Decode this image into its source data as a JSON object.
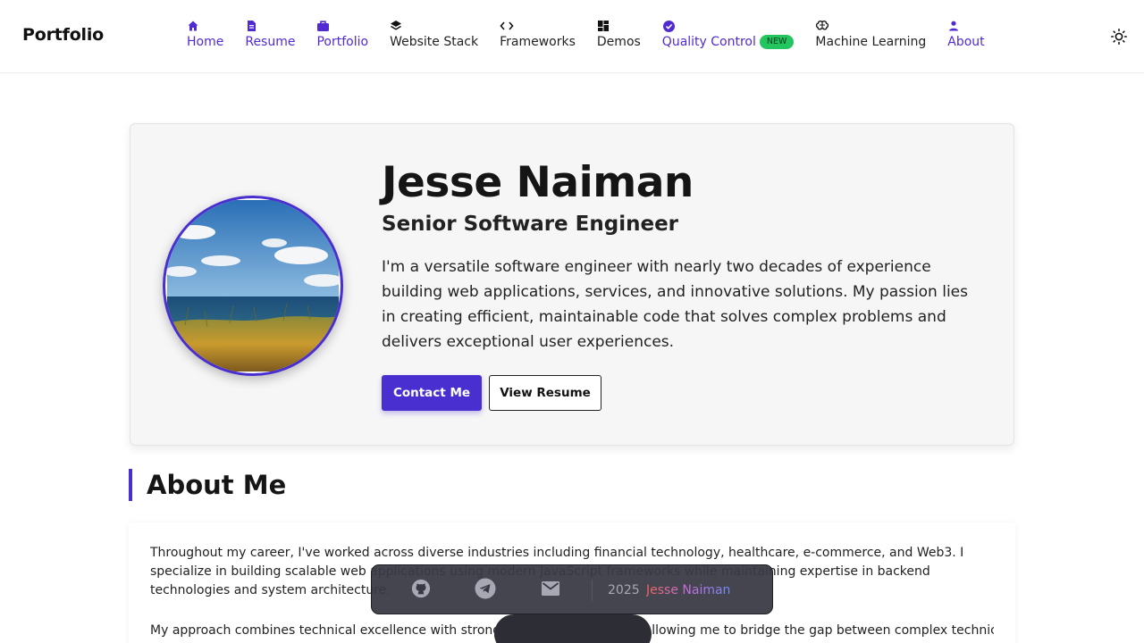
{
  "header": {
    "brand": "Portfolio",
    "nav": [
      {
        "label": "Home",
        "icon": "home-icon",
        "active": true
      },
      {
        "label": "Resume",
        "icon": "document-icon",
        "active": true
      },
      {
        "label": "Portfolio",
        "icon": "briefcase-icon",
        "active": true
      },
      {
        "label": "Website Stack",
        "icon": "layers-icon",
        "active": false
      },
      {
        "label": "Frameworks",
        "icon": "code-icon",
        "active": false
      },
      {
        "label": "Demos",
        "icon": "grid-icon",
        "active": false
      },
      {
        "label": "Quality Control",
        "icon": "verified-badge-icon",
        "active": true,
        "badge": "NEW"
      },
      {
        "label": "Machine Learning",
        "icon": "brain-icon",
        "active": false
      },
      {
        "label": "About",
        "icon": "person-icon",
        "active": true
      }
    ],
    "theme_toggle_icon": "sun-icon"
  },
  "hero": {
    "name": "Jesse Naiman",
    "role": "Senior Software Engineer",
    "bio": "I'm a versatile software engineer with nearly two decades of experience building web applications, services, and innovative solutions. My passion lies in creating efficient, maintainable code that solves complex problems and delivers exceptional user experiences.",
    "primary_button": "Contact Me",
    "secondary_button": "View Resume",
    "avatar_icon": "profile-photo-seascape"
  },
  "about": {
    "heading": "About Me",
    "paragraphs": [
      "Throughout my career, I've worked across diverse industries including financial technology, healthcare, e-commerce, and Web3. I specialize in building scalable web applications using modern JavaScript frameworks while maintaining expertise in backend technologies and system architecture.",
      "My approach combines technical excellence with strong communication skills, allowing me to bridge the gap between complex technical"
    ]
  },
  "footer": {
    "icons": [
      "github-icon",
      "telegram-icon",
      "mail-icon"
    ],
    "year": "2025",
    "name": "Jesse Naiman"
  },
  "colors": {
    "accent": "#4a2fd0",
    "badge": "#22c55e",
    "hero_bg": "#f6f6f6",
    "dock_bg": "#383944"
  }
}
